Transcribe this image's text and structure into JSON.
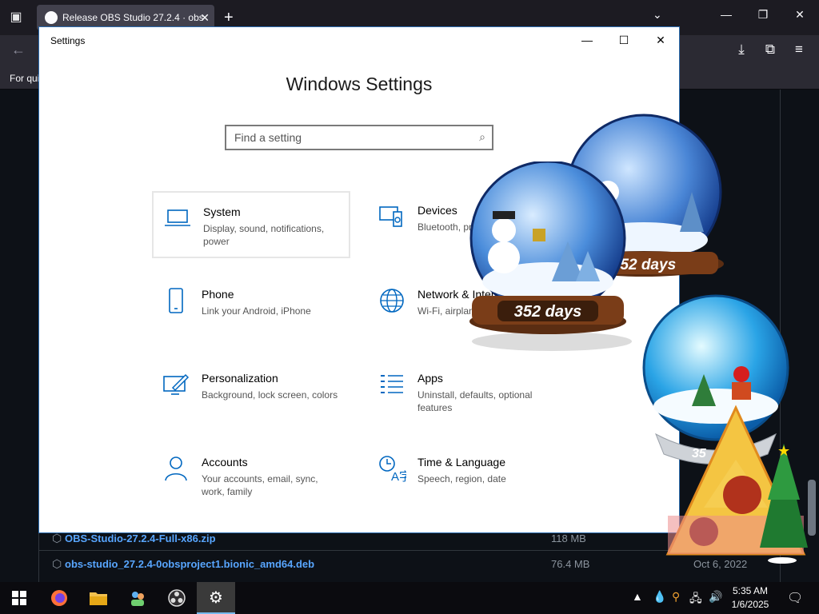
{
  "browser": {
    "tab_title": "Release OBS Studio 27.2.4 · obs",
    "tab_close": "✕",
    "new_tab": "+",
    "bookmarks_label": "For qui"
  },
  "assets": [
    {
      "name": "OBS-Studio-27.2.4-Full-x86.zip",
      "size": "118 MB",
      "date": ""
    },
    {
      "name": "obs-studio_27.2.4-0obsproject1.bionic_amd64.deb",
      "size": "76.4 MB",
      "date": "Oct 6, 2022"
    }
  ],
  "settings": {
    "window_title": "Settings",
    "heading": "Windows Settings",
    "search_placeholder": "Find a setting",
    "categories": [
      {
        "title": "System",
        "desc": "Display, sound, notifications, power",
        "icon": "laptop-icon"
      },
      {
        "title": "Devices",
        "desc": "Bluetooth, printers, mouse",
        "icon": "devices-icon"
      },
      {
        "title": "Phone",
        "desc": "Link your Android, iPhone",
        "icon": "phone-icon"
      },
      {
        "title": "Network & Internet",
        "desc": "Wi-Fi, airplane mode, VPN",
        "icon": "globe-icon"
      },
      {
        "title": "Personalization",
        "desc": "Background, lock screen, colors",
        "icon": "paint-icon"
      },
      {
        "title": "Apps",
        "desc": "Uninstall, defaults, optional features",
        "icon": "apps-list-icon"
      },
      {
        "title": "Accounts",
        "desc": "Your accounts, email, sync, work, family",
        "icon": "person-icon"
      },
      {
        "title": "Time & Language",
        "desc": "Speech, region, date",
        "icon": "time-language-icon"
      }
    ]
  },
  "decorations": {
    "countdown_1": "352 days",
    "countdown_2": "352 days",
    "countdown_3": "35"
  },
  "taskbar": {
    "time": "5:35 AM",
    "date": "1/6/2025"
  },
  "colors": {
    "accent": "#0067c0",
    "link": "#58a6ff"
  }
}
